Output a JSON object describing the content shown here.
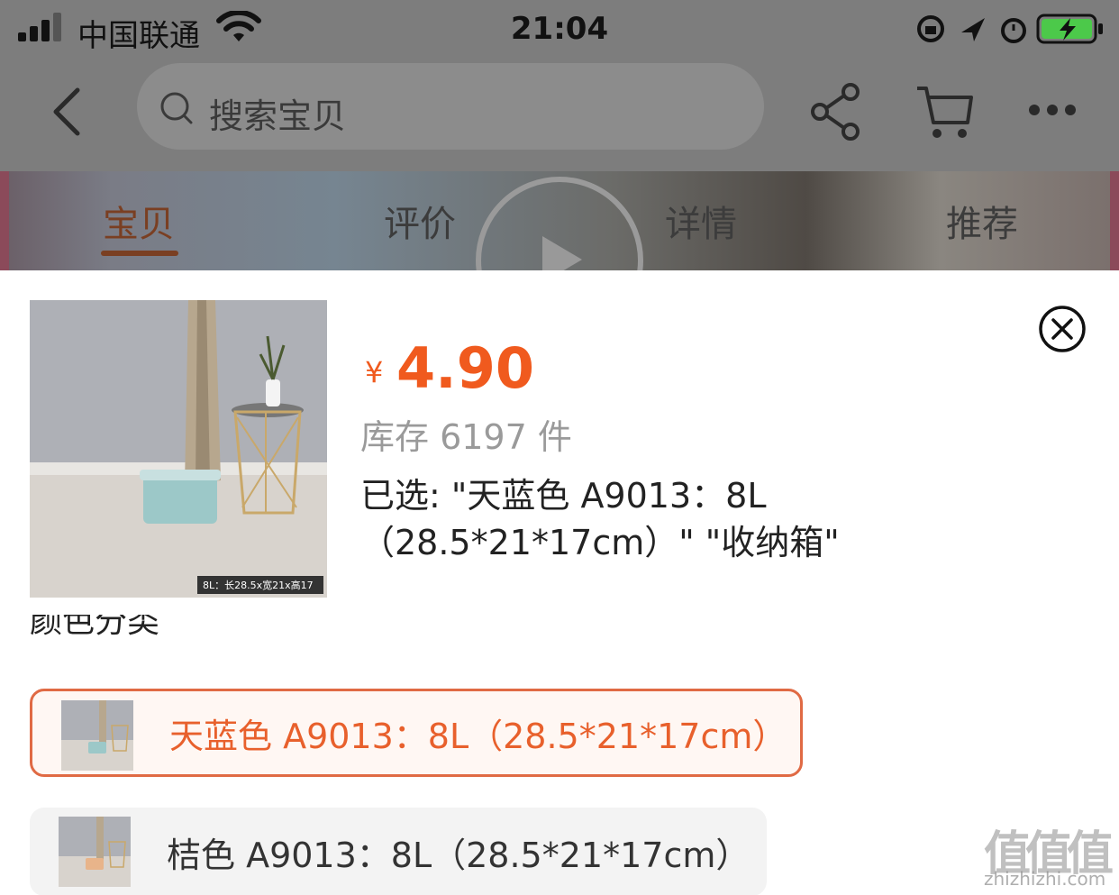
{
  "status_bar": {
    "carrier": "中国联通",
    "time": "21:04"
  },
  "nav": {
    "search_placeholder": "搜索宝贝"
  },
  "tabs": [
    {
      "label": "宝贝",
      "active": true
    },
    {
      "label": "评价",
      "active": false
    },
    {
      "label": "详情",
      "active": false
    },
    {
      "label": "推荐",
      "active": false
    }
  ],
  "product": {
    "currency": "¥",
    "price": "4.90",
    "stock": "库存 6197 件",
    "selected_line1": "已选: \"天蓝色 A9013：8L",
    "selected_line2": "（28.5*21*17cm）\" \"收纳箱\"",
    "thumb_caption": "8L：长28.5x宽21x高17"
  },
  "section": {
    "title": "颜色分类"
  },
  "options": [
    {
      "label": "天蓝色 A9013：8L（28.5*21*17cm）",
      "selected": true,
      "box_color": "#9cc8c8"
    },
    {
      "label": "桔色 A9013：8L（28.5*21*17cm）",
      "selected": false,
      "box_color": "#e8b48a"
    }
  ],
  "watermark": {
    "glyphs": "值值值",
    "url": "zhizhizhi.com"
  },
  "colors": {
    "accent": "#f05a1e",
    "selected_border": "#e06a44"
  }
}
